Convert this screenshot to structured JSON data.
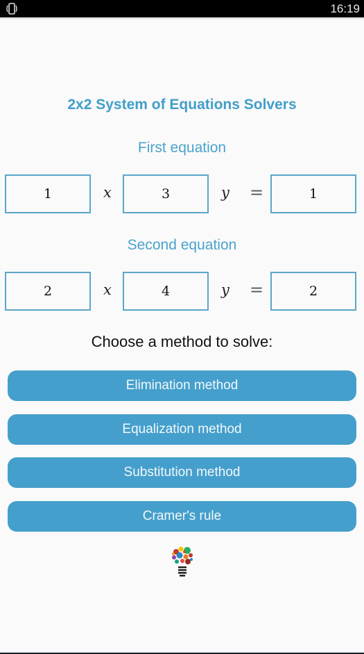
{
  "status_bar": {
    "icon": "phone-rotate-icon",
    "time": "16:19"
  },
  "header": {
    "title": "2x2 System of Equations Solvers"
  },
  "equations": [
    {
      "label": "First equation",
      "a": "1",
      "x_symbol": "x",
      "b": "3",
      "y_symbol": "y",
      "equals": "=",
      "c": "1"
    },
    {
      "label": "Second equation",
      "a": "2",
      "x_symbol": "x",
      "b": "4",
      "y_symbol": "y",
      "equals": "=",
      "c": "2"
    }
  ],
  "methods": {
    "prompt": "Choose a method to solve:",
    "buttons": [
      {
        "label": "Elimination method"
      },
      {
        "label": "Equalization method"
      },
      {
        "label": "Substitution method"
      },
      {
        "label": "Cramer's rule"
      }
    ]
  },
  "footer": {
    "logo_icon": "lightbulb-icon"
  },
  "colors": {
    "accent": "#459fcc",
    "title": "#419ec9",
    "box_border": "#5aa6c9"
  }
}
